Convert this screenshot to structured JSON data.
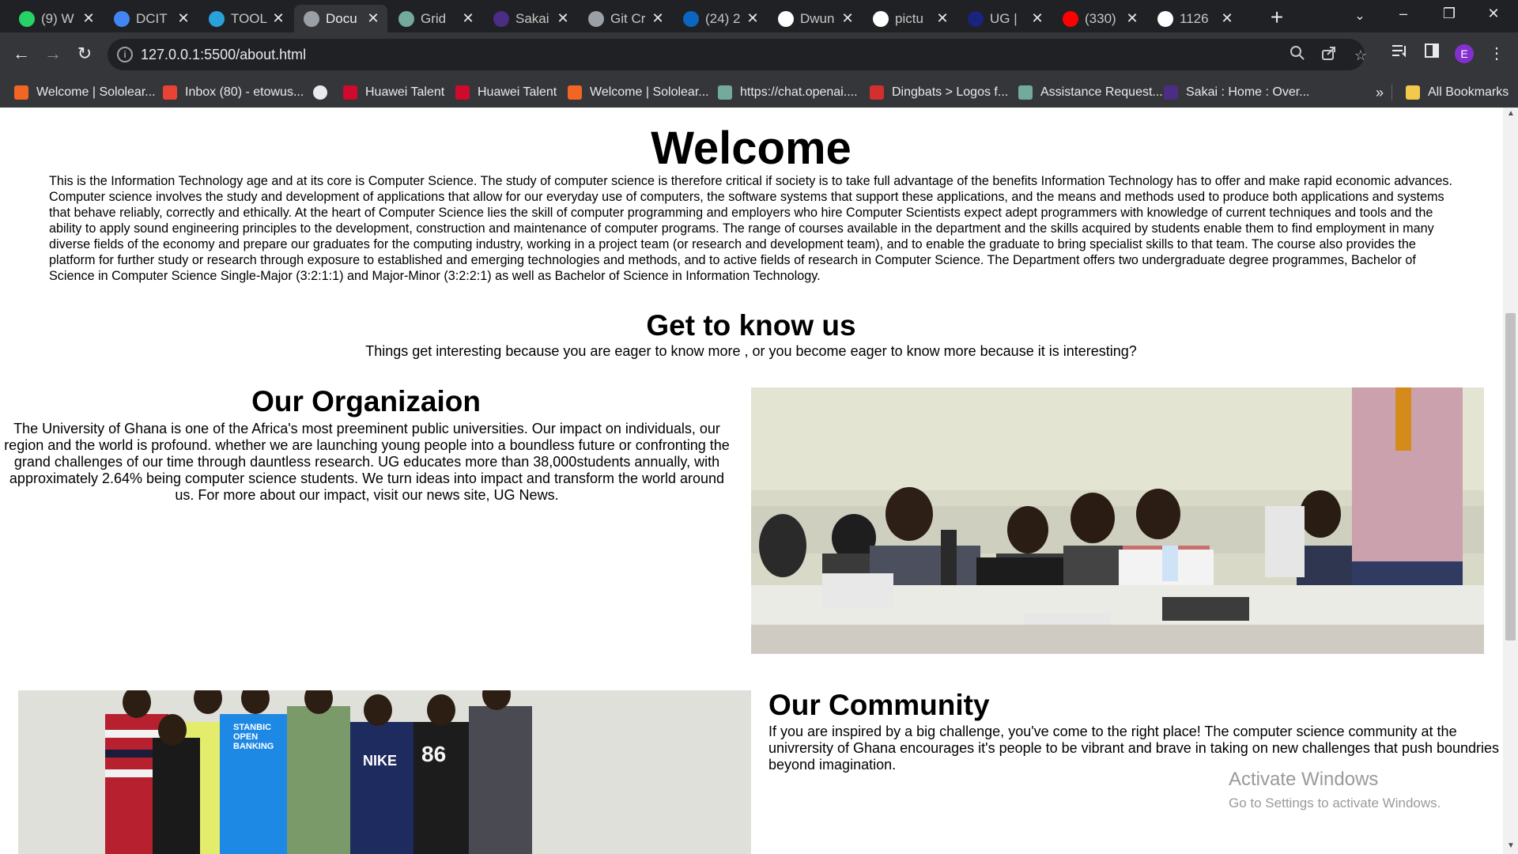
{
  "tabs": [
    {
      "title": "(9) W",
      "icon": "whatsapp-icon",
      "color": "#25d366",
      "active": false
    },
    {
      "title": "DCIT",
      "icon": "docs-icon",
      "color": "#4285f4",
      "active": false
    },
    {
      "title": "TOOL",
      "icon": "telegram-icon",
      "color": "#2aa1da",
      "active": false
    },
    {
      "title": "Docu",
      "icon": "globe-icon",
      "color": "#9aa0a6",
      "active": true
    },
    {
      "title": "Grid",
      "icon": "openai-icon",
      "color": "#74aa9c",
      "active": false
    },
    {
      "title": "Sakai",
      "icon": "sakai-icon",
      "color": "#4b2e83",
      "active": false
    },
    {
      "title": "Git Cr",
      "icon": "globe-icon",
      "color": "#9aa0a6",
      "active": false
    },
    {
      "title": "(24) 2",
      "icon": "linkedin-icon",
      "color": "#0a66c2",
      "active": false
    },
    {
      "title": "Dwun",
      "icon": "google-icon",
      "color": "#ffffff",
      "active": false
    },
    {
      "title": "pictu",
      "icon": "google-icon",
      "color": "#ffffff",
      "active": false
    },
    {
      "title": "UG |",
      "icon": "ug-icon",
      "color": "#1a237e",
      "active": false
    },
    {
      "title": "(330)",
      "icon": "youtube-icon",
      "color": "#ff0000",
      "active": false
    },
    {
      "title": "1126",
      "icon": "github-icon",
      "color": "#ffffff",
      "active": false
    }
  ],
  "toolbar": {
    "url": "127.0.0.1:5500/about.html",
    "profile_initial": "E"
  },
  "bookmarks": [
    {
      "label": "Welcome | Sololear...",
      "icon": "sololearn-icon",
      "color": "#f26522"
    },
    {
      "label": "Inbox (80) - etowus...",
      "icon": "gmail-icon",
      "color": "#ea4335"
    },
    {
      "label": "",
      "icon": "globe-icon",
      "color": "#e8eaed"
    },
    {
      "label": "Huawei Talent",
      "icon": "huawei-icon",
      "color": "#cf0a2c"
    },
    {
      "label": "Huawei Talent",
      "icon": "huawei-icon",
      "color": "#cf0a2c"
    },
    {
      "label": "Welcome | Sololear...",
      "icon": "sololearn-icon",
      "color": "#f26522"
    },
    {
      "label": "https://chat.openai....",
      "icon": "openai-icon",
      "color": "#74aa9c"
    },
    {
      "label": "Dingbats > Logos f...",
      "icon": "dingbats-icon",
      "color": "#d32f2f"
    },
    {
      "label": "Assistance Request...",
      "icon": "openai-icon",
      "color": "#74aa9c"
    },
    {
      "label": "Sakai : Home : Over...",
      "icon": "sakai-icon",
      "color": "#4b2e83"
    }
  ],
  "bookmarks_overflow": "»",
  "all_bookmarks": "All Bookmarks",
  "page": {
    "welcome_title": "Welcome",
    "intro": "This is the Information Technology age and at its core is Computer Science. The study of computer science is therefore critical if society is to take full advantage of the benefits Information Technology has to offer and make rapid economic advances. Computer science involves the study and development of applications that allow for our everyday use of computers, the software systems that support these applications, and the means and methods used to produce both applications and systems that behave reliably, correctly and ethically. At the heart of Computer Science lies the skill of computer programming and employers who hire Computer Scientists expect adept programmers with knowledge of current techniques and tools and the ability to apply sound engineering principles to the development, construction and maintenance of computer programs. The range of courses available in the department and the skills acquired by students enable them to find employment in many diverse fields of the economy and prepare our graduates for the computing industry, working in a project team (or research and development team), and to enable the graduate to bring specialist skills to that team. The course also provides the platform for further study or research through exposure to established and emerging technologies and methods, and to active fields of research in Computer Science. The Department offers two undergraduate degree programmes, Bachelor of Science in Computer Science Single-Major (3:2:1:1) and Major-Minor (3:2:2:1) as well as Bachelor of Science in Information Technology.",
    "gtk_title": "Get to know us",
    "gtk_subtitle": "Things get interesting because you are eager to know more , or you become eager to know more because it is interesting?",
    "org_title": "Our Organizaion",
    "org_text": "The University of Ghana is one of the Africa's most preeminent public universities. Our impact on individuals, our region and the world is profound. whether we are launching young people into a boundless future or confronting the grand challenges of our time through dauntless research. UG educates more than 38,000students annually, with approximately 2.64% being computer science students. We turn ideas into impact and transform the world around us. For more about our impact, visit our news site, UG News.",
    "community_title": "Our Community",
    "community_text": "If you are inspired by a big challenge, you've come to the right place! The computer science community at the univrersity of Ghana encourages it's people to be vibrant and brave in taking on new challenges that push boundries beyond imagination.",
    "community_photo_shirt_text": "STANBIC OPEN BANKING",
    "community_photo_shirt_text2": "NIKE",
    "community_photo_shirt_text3": "86"
  },
  "watermark": {
    "line1": "Activate Windows",
    "line2": "Go to Settings to activate Windows."
  }
}
